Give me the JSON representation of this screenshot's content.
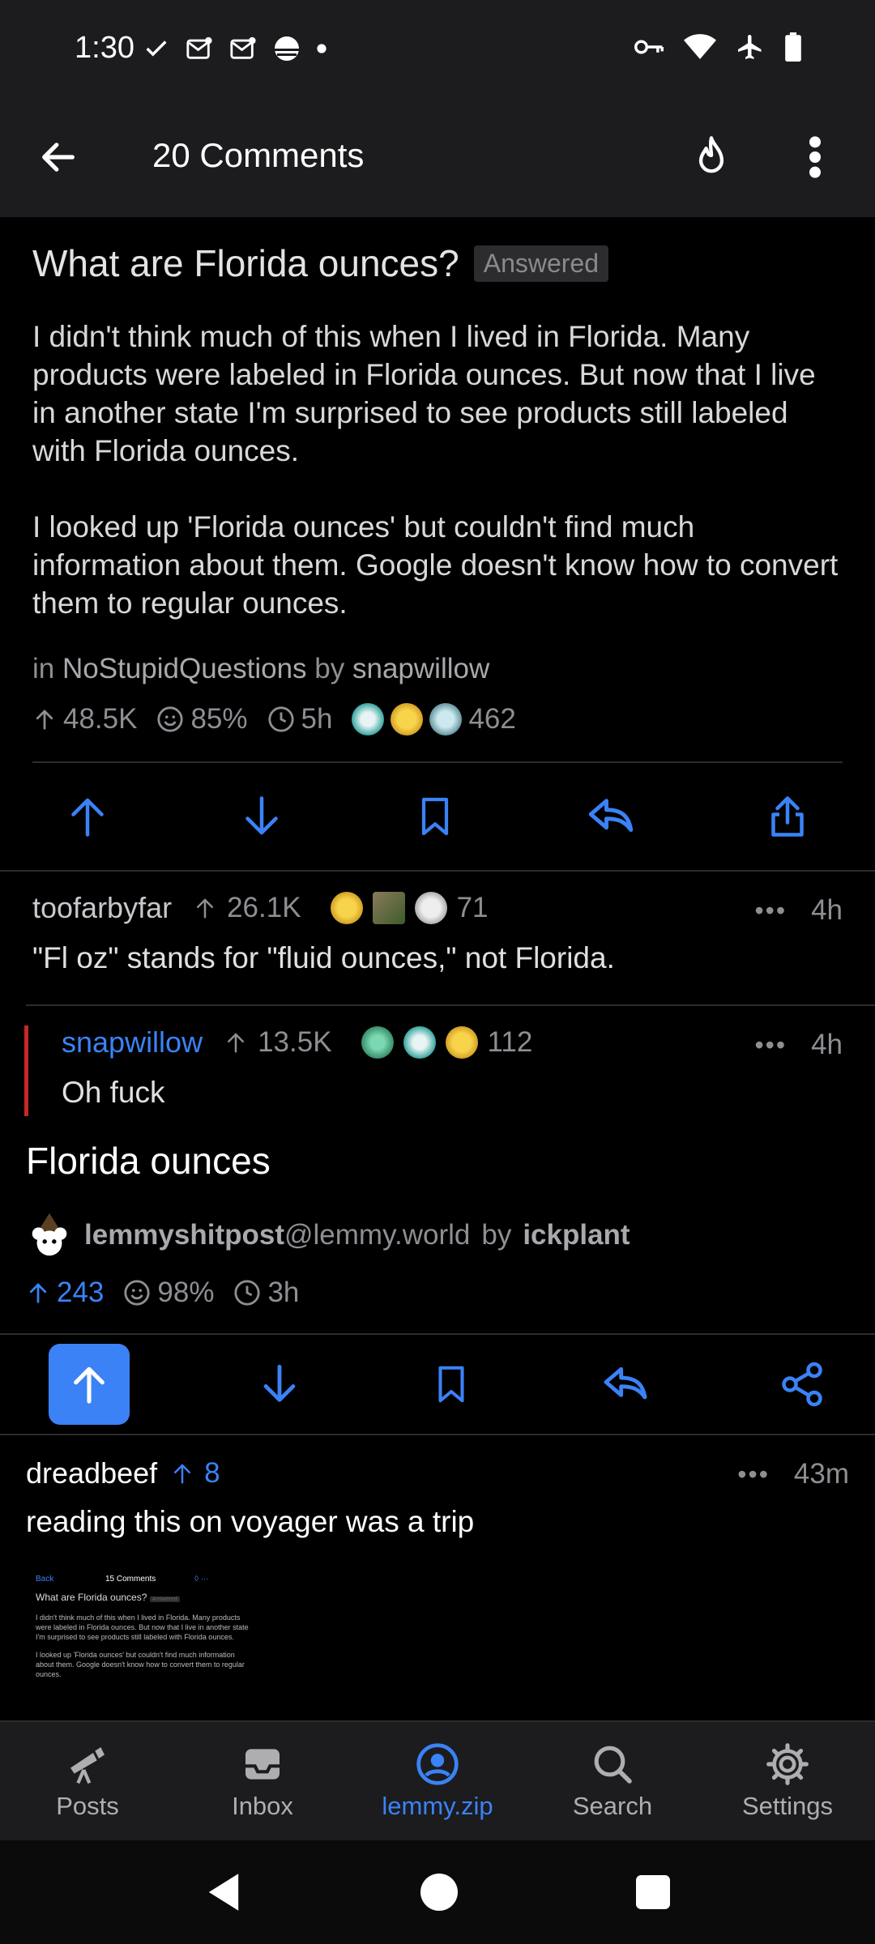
{
  "status_bar": {
    "time": "1:30"
  },
  "app_bar": {
    "title": "20 Comments"
  },
  "post": {
    "title": "What are Florida ounces?",
    "badge": "Answered",
    "body": [
      "I didn't think much of this when I lived in Florida. Many products were labeled in Florida ounces. But now that I live in another state I'm surprised to see products still labeled with Florida ounces.",
      "I looked up 'Florida ounces' but couldn't find much information about them. Google doesn't know how to convert them to regular ounces."
    ],
    "in_label": "in",
    "community": "NoStupidQuestions",
    "by_label": "by",
    "author": "snapwillow",
    "score": "48.5K",
    "upvote_pct": "85%",
    "age": "5h",
    "award_count": "462"
  },
  "comments": [
    {
      "author": "toofarbyfar",
      "score": "26.1K",
      "award_count": "71",
      "age": "4h",
      "text": "\"Fl oz\" stands for \"fluid ounces,\" not Florida."
    },
    {
      "author": "snapwillow",
      "score": "13.5K",
      "award_count": "112",
      "age": "4h",
      "text": "Oh fuck"
    }
  ],
  "cross_post": {
    "title": "Florida ounces",
    "community": "lemmyshitpost",
    "instance": "@lemmy.world",
    "by_label": "by",
    "author": "ickplant",
    "score": "243",
    "upvote_pct": "98%",
    "age": "3h"
  },
  "reply": {
    "author": "dreadbeef",
    "score": "8",
    "age": "43m",
    "text": "reading this on voyager was a trip"
  },
  "thumbnail": {
    "back": "Back",
    "header": "15 Comments",
    "title": "What are Florida ounces?",
    "badge": "Answered",
    "para1": "I didn't think much of this when I lived in Florida. Many products were labeled in Florida ounces. But now that I live in another state I'm surprised to see products still labeled with Florida ounces.",
    "para2": "I looked up 'Florida ounces' but couldn't find much information about them. Google doesn't know how to convert them to regular ounces."
  },
  "nav": [
    {
      "label": "Posts",
      "icon": "telescope-icon"
    },
    {
      "label": "Inbox",
      "icon": "inbox-icon"
    },
    {
      "label": "lemmy.zip",
      "icon": "account-icon"
    },
    {
      "label": "Search",
      "icon": "search-icon"
    },
    {
      "label": "Settings",
      "icon": "gear-icon"
    }
  ],
  "colors": {
    "accent": "#3b82f6",
    "background": "#000000",
    "bar": "#1c1c1e",
    "op_line": "#c62828"
  }
}
